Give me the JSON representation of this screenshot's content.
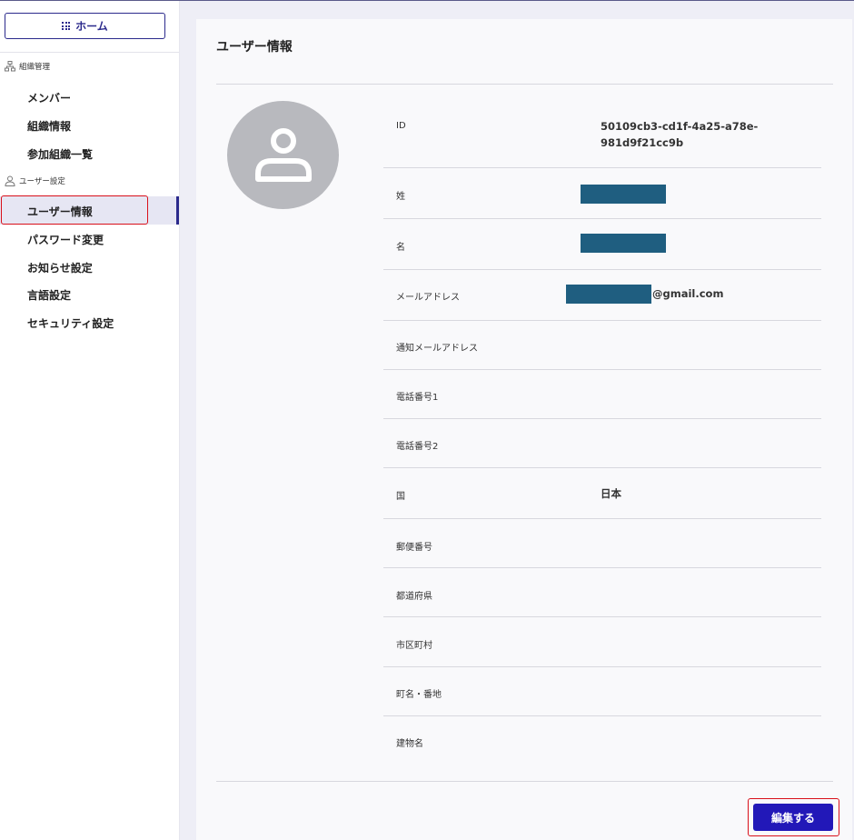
{
  "sidebar": {
    "home_label": "ホーム",
    "sections": [
      {
        "heading": "組織管理",
        "items": [
          "メンバー",
          "組織情報",
          "参加組織一覧"
        ]
      },
      {
        "heading": "ユーザー設定",
        "items": [
          "ユーザー情報",
          "パスワード変更",
          "お知らせ設定",
          "言語設定",
          "セキュリティ設定"
        ]
      }
    ],
    "active_item": "ユーザー情報"
  },
  "main": {
    "title": "ユーザー情報",
    "fields": [
      {
        "label": "ID",
        "value_line1": "50109cb3-cd1f-4a25-a78e-",
        "value_line2": "981d9f21cc9b"
      },
      {
        "label": "姓",
        "value": "",
        "redacted": true
      },
      {
        "label": "名",
        "value": "",
        "redacted": true
      },
      {
        "label": "メールアドレス",
        "value": "@gmail.com",
        "redacted": true
      },
      {
        "label": "通知メールアドレス",
        "value": ""
      },
      {
        "label": "電話番号1",
        "value": ""
      },
      {
        "label": "電話番号2",
        "value": ""
      },
      {
        "label": "国",
        "value": "日本"
      },
      {
        "label": "郵便番号",
        "value": ""
      },
      {
        "label": "都道府県",
        "value": ""
      },
      {
        "label": "市区町村",
        "value": ""
      },
      {
        "label": "町名・番地",
        "value": ""
      },
      {
        "label": "建物名",
        "value": ""
      }
    ],
    "edit_label": "編集する"
  },
  "colors": {
    "accent": "#2b2a8c",
    "button": "#2218b8",
    "highlight": "#d9101a",
    "redaction": "#1f5e80",
    "avatar": "#b8b9be"
  },
  "icons": {
    "home": "grid-icon",
    "org": "org-chart-icon",
    "user_settings": "user-icon",
    "avatar": "person-icon"
  }
}
